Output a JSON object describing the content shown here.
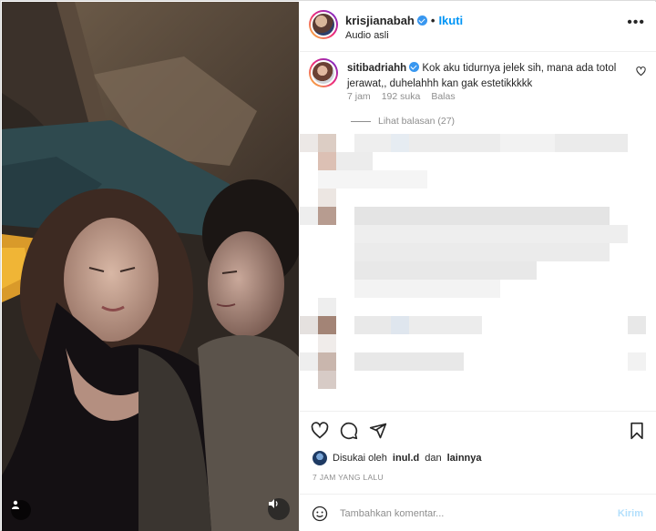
{
  "header": {
    "username": "krisjianabah",
    "separator": "•",
    "follow_label": "Ikuti",
    "subtitle": "Audio asli",
    "more_label": "•••"
  },
  "comment": {
    "username": "sitibadriahh",
    "text": "Kok aku tidurnya jelek sih, mana ada totol jerawat,, duhelahhh kan gak estetikkkkk",
    "time": "7 jam",
    "likes": "192 suka",
    "reply_label": "Balas",
    "view_replies": "Lihat balasan (27)"
  },
  "likes": {
    "prefix": "Disukai oleh",
    "user": "inul.d",
    "connector": "dan",
    "others": "lainnya"
  },
  "post_time": "7 JAM YANG LALU",
  "add_comment": {
    "placeholder": "Tambahkan komentar...",
    "post_label": "Kirim"
  },
  "icons": {
    "verified": "verified-badge-icon",
    "heart": "heart-icon",
    "comment": "comment-icon",
    "share": "share-icon",
    "save": "bookmark-icon",
    "emoji": "emoji-icon",
    "tag": "user-tag-icon",
    "audio": "audio-icon"
  },
  "colors": {
    "accent": "#0095f6",
    "muted": "#8e8e8e",
    "post_disabled": "#b2dffc"
  }
}
